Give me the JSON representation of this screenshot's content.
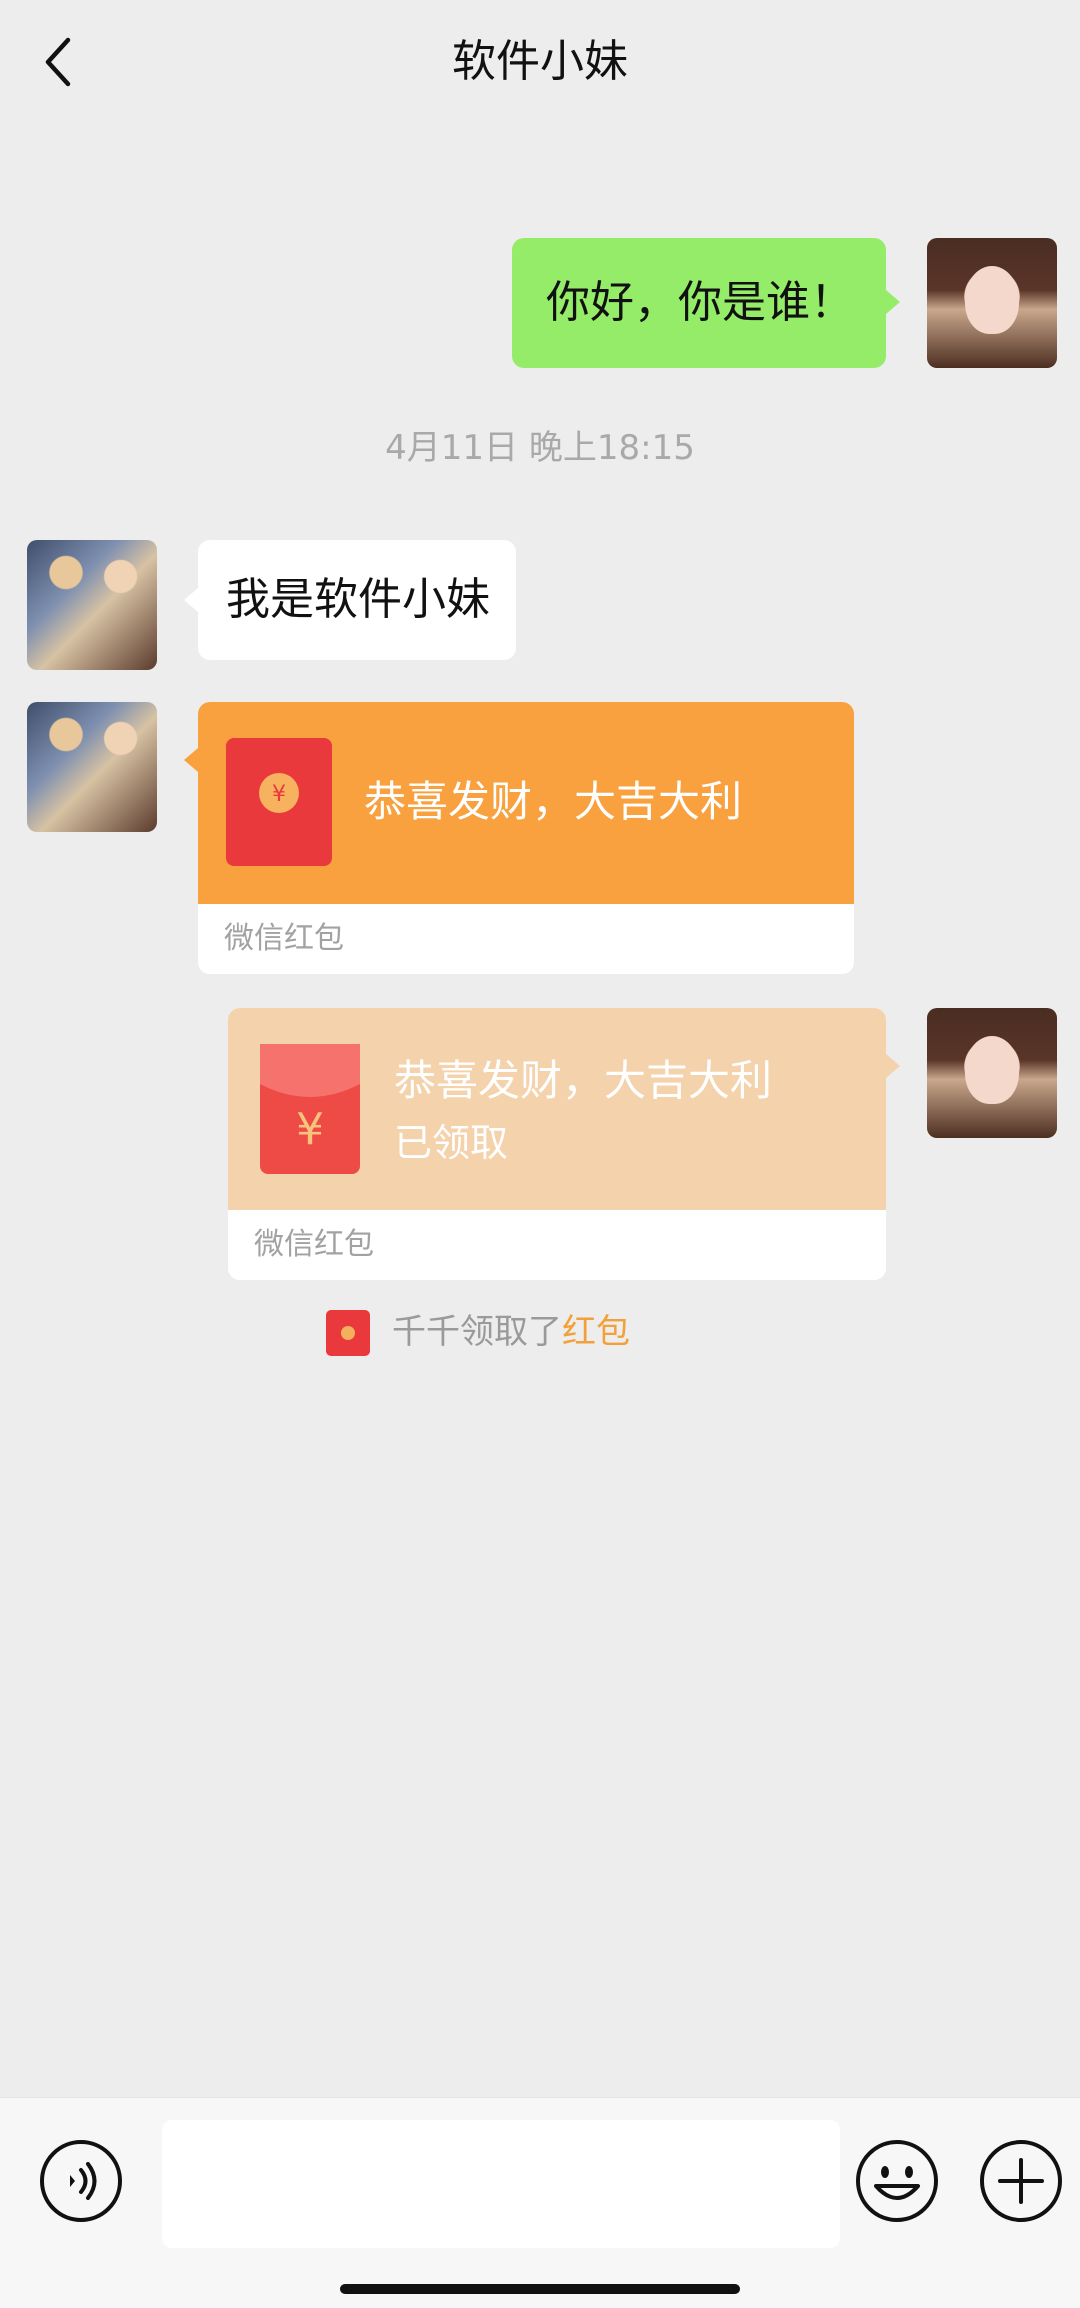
{
  "header": {
    "title": "软件小妹"
  },
  "messages": {
    "m1": "你好，你是谁！",
    "timestamp": "4月11日 晚上18:15",
    "m2": "我是软件小妹",
    "rp_received": {
      "title": "恭喜发财，大吉大利",
      "footer": "微信红包"
    },
    "rp_sent": {
      "title": "恭喜发财，大吉大利",
      "status": "已领取",
      "footer": "微信红包"
    }
  },
  "notice": {
    "prefix": "千千领取了",
    "link": "红包"
  },
  "colors": {
    "background": "#ededed",
    "bubble_self": "#95ec69",
    "bubble_other": "#ffffff",
    "red_packet_active": "#f9a03f",
    "red_packet_opened": "#f4d2ab",
    "red_packet_icon": "#e9393d"
  },
  "icons": [
    "back-arrow-icon",
    "voice-icon",
    "emoji-icon",
    "plus-icon",
    "red-envelope-icon"
  ]
}
